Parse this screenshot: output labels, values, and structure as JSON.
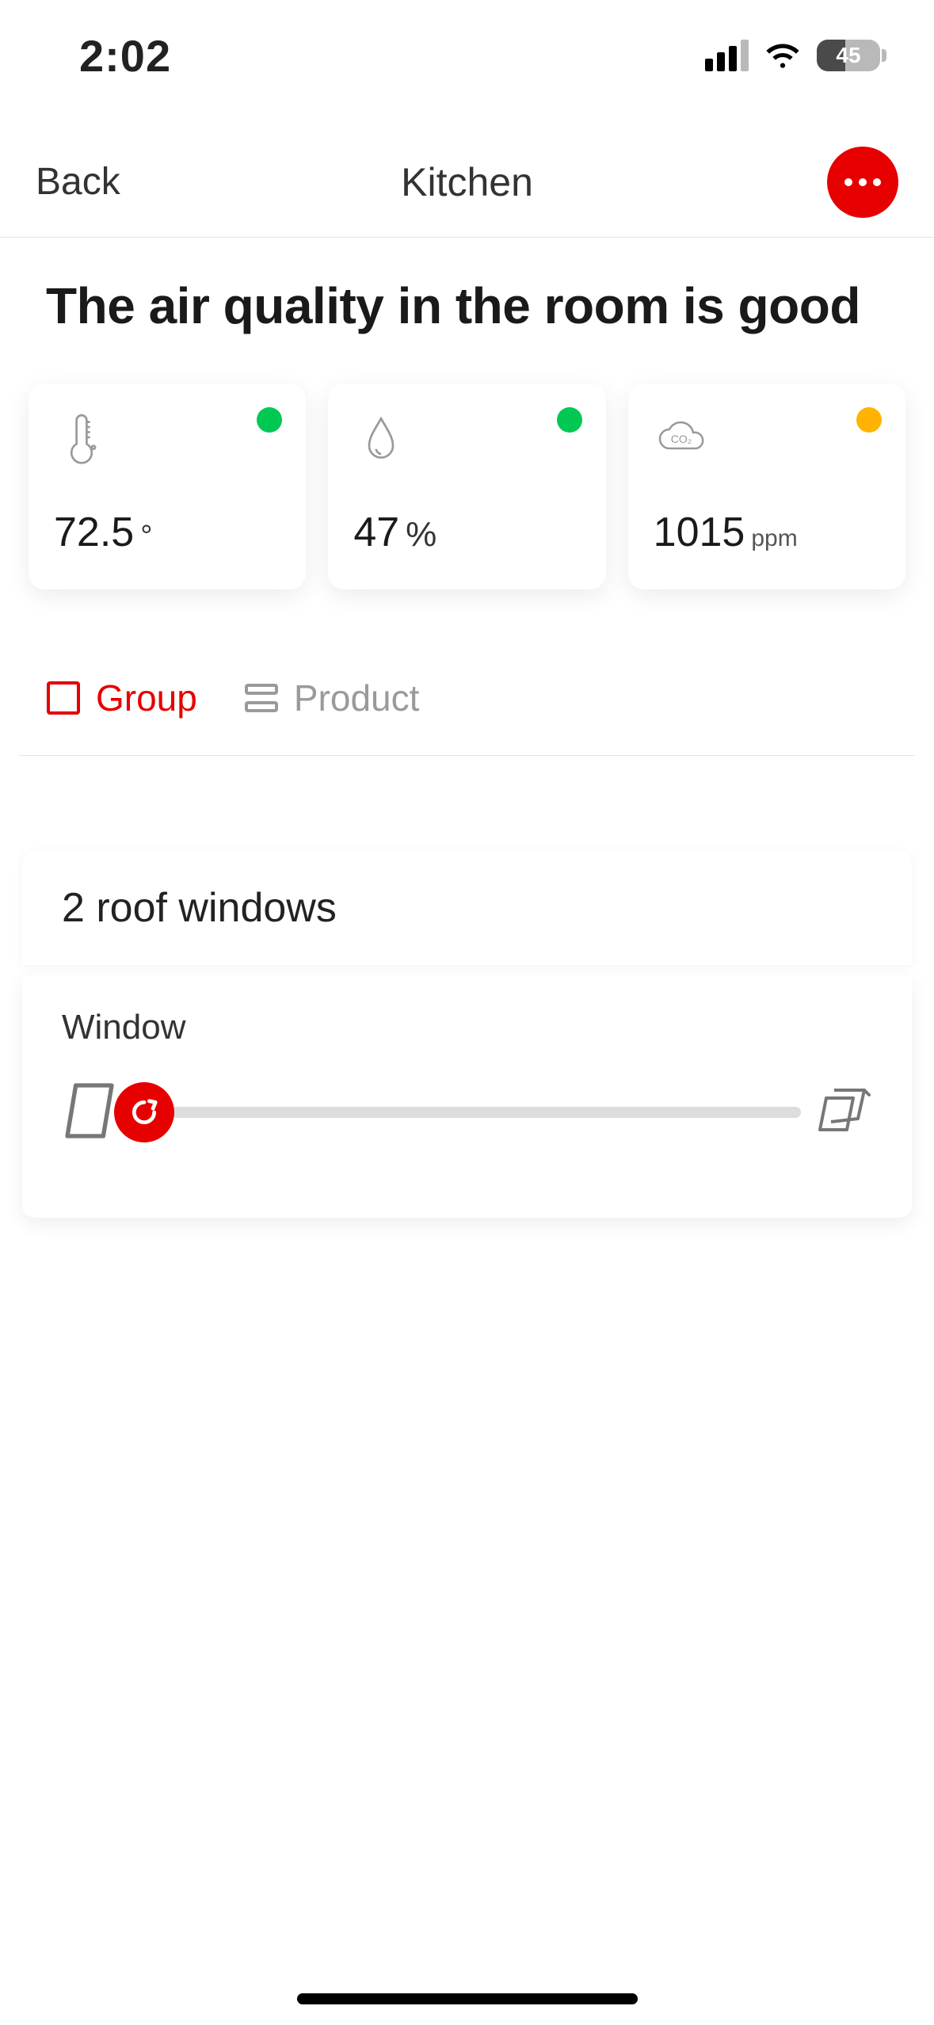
{
  "status_bar": {
    "time": "2:02",
    "battery_text": "45"
  },
  "nav": {
    "back_label": "Back",
    "title": "Kitchen"
  },
  "headline": "The air quality in the room is good",
  "metrics": {
    "temperature": {
      "value": "72.5",
      "unit": "°",
      "status": "green"
    },
    "humidity": {
      "value": "47",
      "unit": "%",
      "status": "green"
    },
    "co2": {
      "value": "1015",
      "unit": "ppm",
      "status": "amber"
    }
  },
  "tabs": {
    "group_label": "Group",
    "product_label": "Product"
  },
  "devices": {
    "section_title": "2 roof windows",
    "item_label": "Window"
  }
}
